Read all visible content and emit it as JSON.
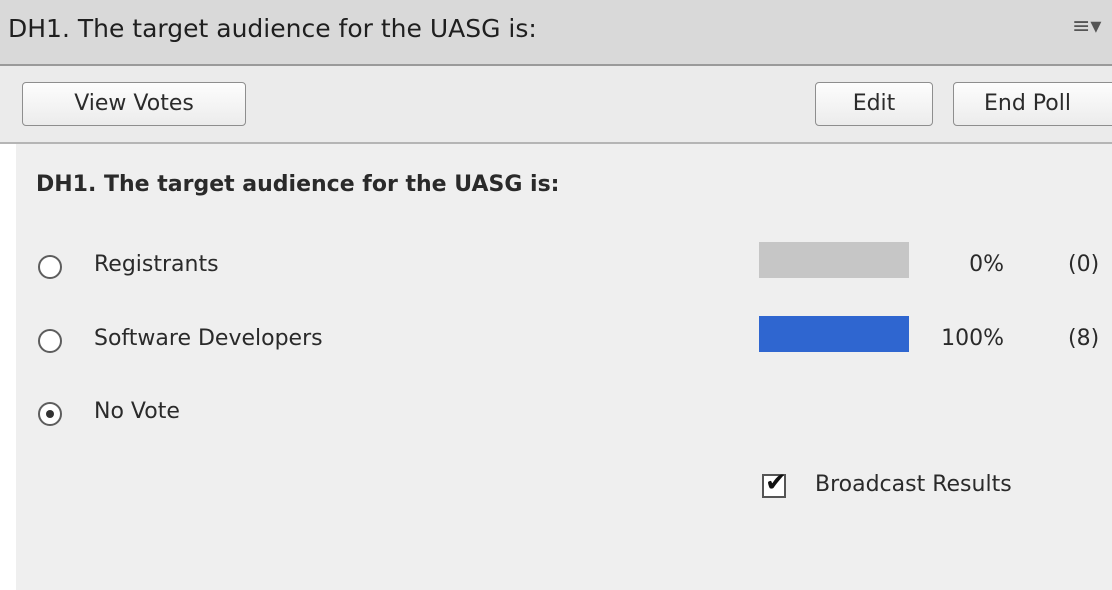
{
  "header": {
    "title": "DH1. The target audience for the UASG is:",
    "menu_icon": "≡▾"
  },
  "toolbar": {
    "view_votes_label": "View Votes",
    "edit_label": "Edit",
    "end_poll_label": "End Poll"
  },
  "poll": {
    "question": "DH1. The target audience for the UASG is:",
    "options": [
      {
        "label": "Registrants",
        "percent": "0%",
        "count": "(0)",
        "fraction": 0,
        "selected": false
      },
      {
        "label": "Software Developers",
        "percent": "100%",
        "count": "(8)",
        "fraction": 1,
        "selected": false
      },
      {
        "label": "No Vote",
        "selected": true
      }
    ],
    "broadcast_label": "Broadcast Results",
    "broadcast_checked": true
  },
  "colors": {
    "bar_fill": "#2f66d0",
    "bar_empty": "#c6c6c6"
  }
}
